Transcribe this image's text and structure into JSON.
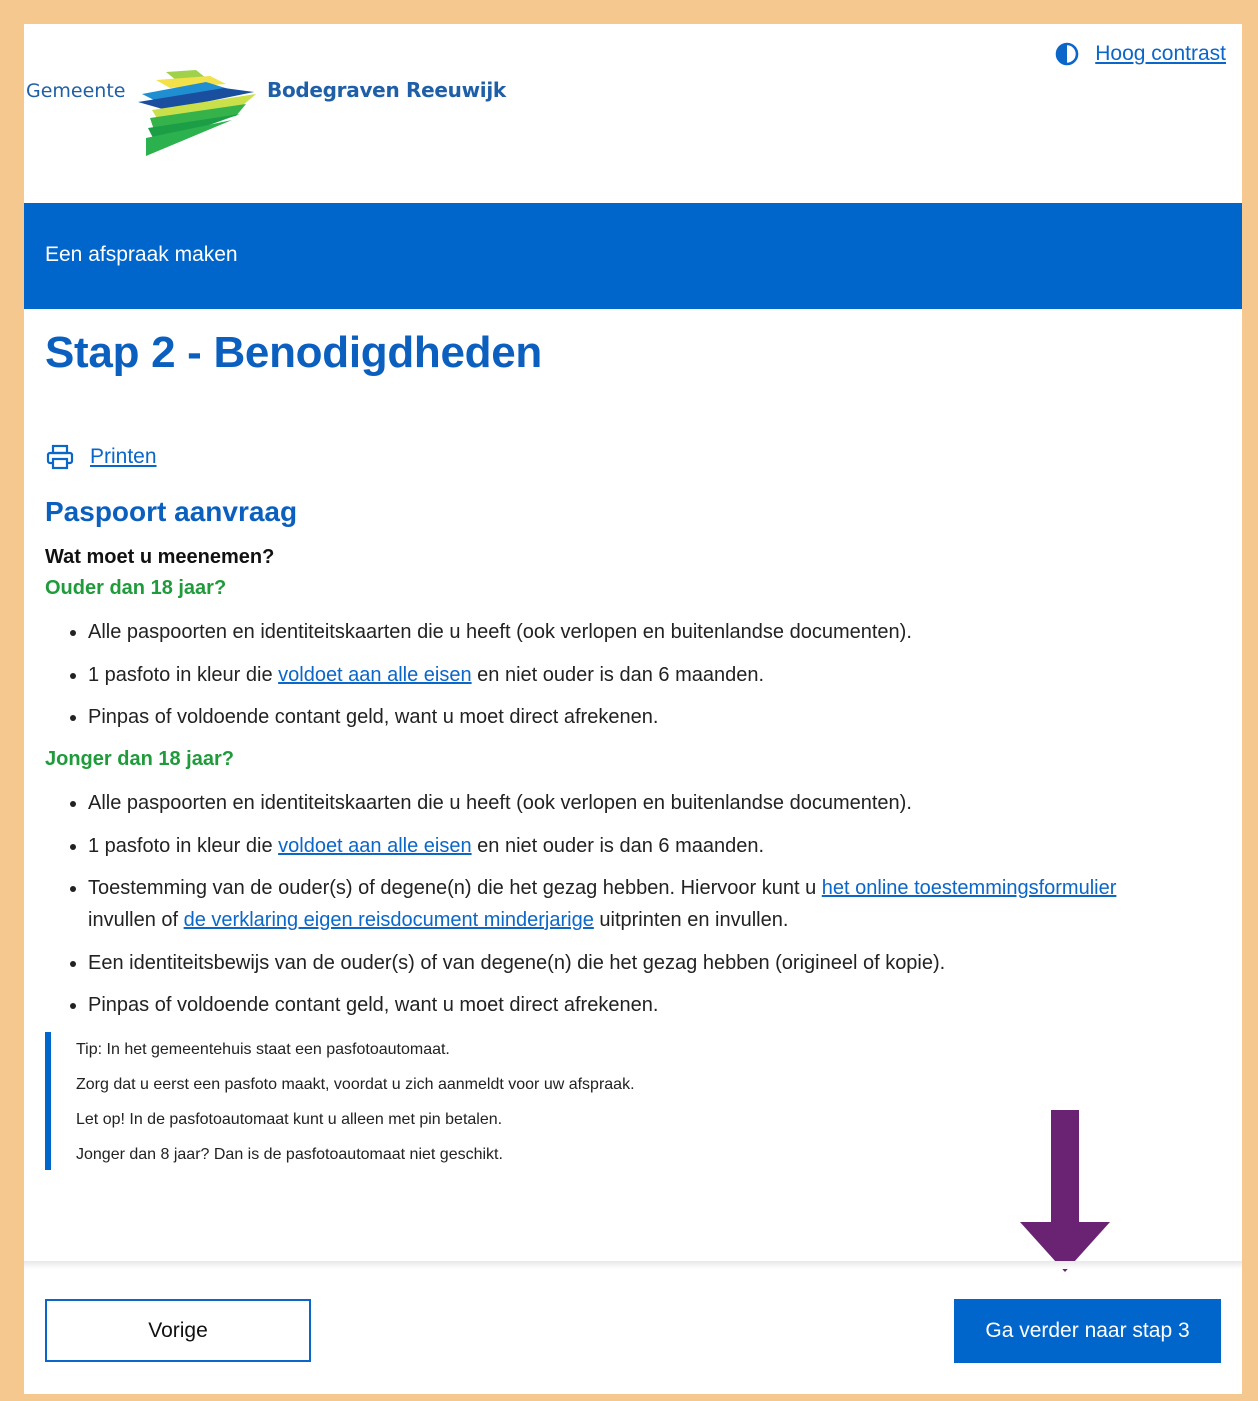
{
  "header": {
    "logo_prefix": "Gemeente",
    "logo_name": "Bodegraven Reeuwijk",
    "contrast_icon": "half-circle-contrast-icon",
    "contrast_label": "Hoog contrast"
  },
  "band": {
    "label": "Een afspraak maken"
  },
  "page_title": "Stap 2 - Benodigdheden",
  "print": {
    "icon": "printer-icon",
    "label": "Printen"
  },
  "section": {
    "title": "Paspoort aanvraag",
    "question": "Wat moet u meenemen?",
    "groups": [
      {
        "title": "Ouder dan 18 jaar?",
        "items": [
          {
            "text": "Alle paspoorten en identiteitskaarten die u heeft (ook verlopen en buitenlandse documenten)."
          },
          {
            "pre": "1 pasfoto in kleur die ",
            "link": "voldoet aan alle eisen",
            "post": " en niet ouder is dan 6 maanden."
          },
          {
            "text": "Pinpas of voldoende contant geld, want u moet direct afrekenen."
          }
        ]
      },
      {
        "title": "Jonger dan 18 jaar?",
        "items": [
          {
            "text": "Alle paspoorten en identiteitskaarten die u heeft (ook verlopen en buitenlandse documenten)."
          },
          {
            "pre": "1 pasfoto in kleur die ",
            "link": "voldoet aan alle eisen",
            "post": " en niet ouder is dan 6 maanden."
          },
          {
            "pre": "Toestemming van de ouder(s) of degene(n) die het gezag hebben. Hiervoor kunt u ",
            "link": "het online toestemmingsformulier",
            "mid": " invullen of ",
            "link2": "de verklaring eigen reisdocument minderjarige",
            "post": " uitprinten en invullen."
          },
          {
            "text": "Een identiteitsbewijs van de ouder(s) of van degene(n) die het gezag hebben (origineel of kopie)."
          },
          {
            "text": "Pinpas of voldoende contant geld, want u moet direct afrekenen."
          }
        ]
      }
    ],
    "tip_lines": [
      "Tip: In het gemeentehuis staat een pasfotoautomaat.",
      "Zorg dat u eerst een pasfoto maakt, voordat u zich aanmeldt voor uw afspraak.",
      "Let op! In de pasfotoautomaat kunt u alleen met pin betalen.",
      "Jonger dan 8 jaar? Dan is de pasfotoautomaat niet geschikt."
    ]
  },
  "annotation": {
    "icon": "down-arrow-icon",
    "color": "#6a2272"
  },
  "footer": {
    "prev_label": "Vorige",
    "next_label": "Ga verder naar stap 3"
  },
  "colors": {
    "frame": "#f4c88f",
    "primary": "#0066cc",
    "heading": "#0a5fbf",
    "green": "#1f9b3b"
  }
}
